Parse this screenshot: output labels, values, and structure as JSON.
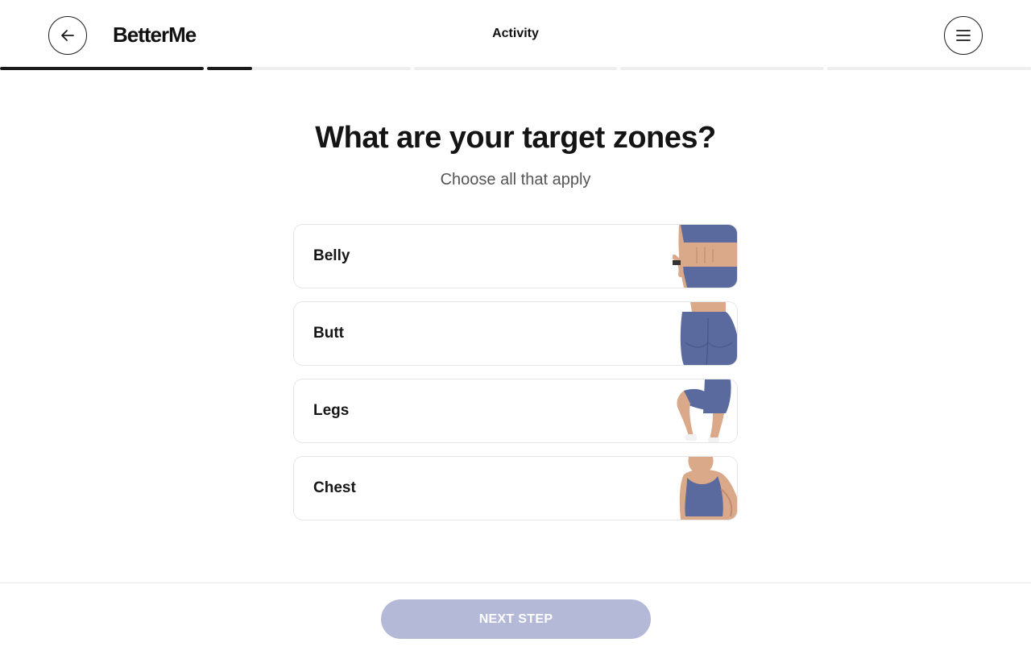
{
  "header": {
    "logo": "BetterMe",
    "section_title": "Activity"
  },
  "progress": {
    "segments": [
      1.0,
      0.22,
      0,
      0,
      0
    ]
  },
  "question": {
    "title": "What are your target zones?",
    "subtitle": "Choose all that apply"
  },
  "options": [
    {
      "label": "Belly"
    },
    {
      "label": "Butt"
    },
    {
      "label": "Legs"
    },
    {
      "label": "Chest"
    }
  ],
  "footer": {
    "next_label": "NEXT STEP",
    "next_color": "#b4b9d8"
  },
  "colors": {
    "accent": "#5a6a9e",
    "text": "#1a1a1a"
  }
}
